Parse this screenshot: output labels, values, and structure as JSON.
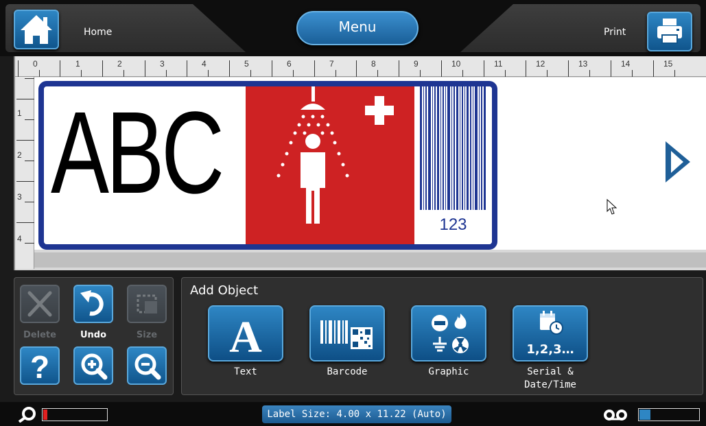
{
  "header": {
    "home_label": "Home",
    "menu_label": "Menu",
    "print_label": "Print"
  },
  "ruler": {
    "horizontal": [
      "0",
      "1",
      "2",
      "3",
      "4",
      "5",
      "6",
      "7",
      "8",
      "9",
      "10",
      "11",
      "12",
      "13",
      "14",
      "15"
    ],
    "vertical": [
      "1",
      "2",
      "3",
      "4"
    ]
  },
  "label": {
    "text_object": "ABC",
    "barcode_number": "123",
    "border_color": "#1e3592",
    "graphic_background": "#ce2223"
  },
  "tools": {
    "delete_label": "Delete",
    "undo_label": "Undo",
    "size_label": "Size"
  },
  "add_object": {
    "title": "Add Object",
    "text_label": "Text",
    "barcode_label": "Barcode",
    "graphic_label": "Graphic",
    "serial_label_line1": "Serial &",
    "serial_label_line2": "Date/Time",
    "serial_icon_text": "1,2,3…"
  },
  "status": {
    "label_size": "Label Size: 4.00 x 11.22 (Auto)",
    "ribbon_level_percent": 8,
    "ribbon_fill_color": "#e02020",
    "label_supply_percent": 20,
    "label_fill_color": "#2e86c4"
  },
  "colors": {
    "accent": "#2e86c4",
    "background": "#1b1b1b"
  }
}
